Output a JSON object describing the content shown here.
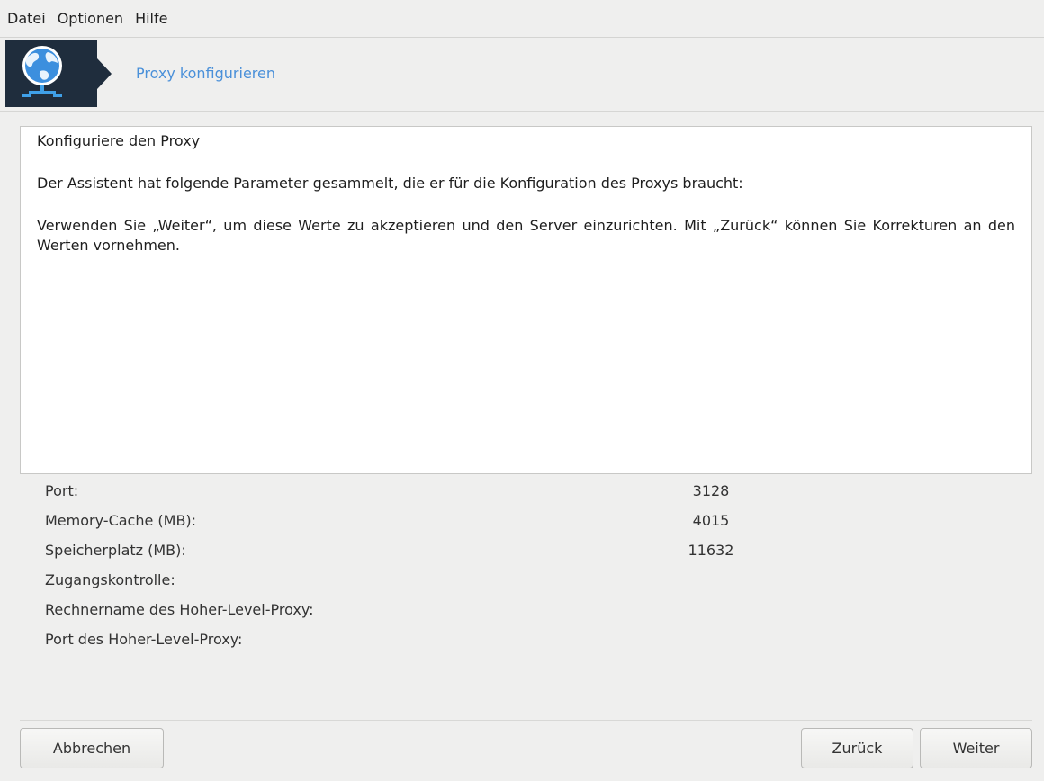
{
  "menubar": {
    "items": [
      "Datei",
      "Optionen",
      "Hilfe"
    ]
  },
  "header": {
    "title": "Proxy konfigurieren",
    "icon": "globe-network-icon"
  },
  "content": {
    "heading": "Konfiguriere den Proxy",
    "intro": "Der Assistent hat folgende Parameter gesammelt, die er für die Konfiguration des Proxys braucht:",
    "instructions": "Verwenden Sie „Weiter“, um diese Werte zu akzeptieren und den Server einzurichten. Mit „Zurück“ können Sie Korrekturen an den Werten vornehmen."
  },
  "parameters": [
    {
      "label": "Port:",
      "value": "3128"
    },
    {
      "label": "Memory-Cache (MB):",
      "value": "4015"
    },
    {
      "label": "Speicherplatz (MB):",
      "value": "11632"
    },
    {
      "label": "Zugangskontrolle:",
      "value": ""
    },
    {
      "label": "Rechnername des Hoher-Level-Proxy:",
      "value": ""
    },
    {
      "label": "Port des Hoher-Level-Proxy:",
      "value": ""
    }
  ],
  "buttons": {
    "cancel": "Abbrechen",
    "back": "Zurück",
    "next": "Weiter"
  },
  "colors": {
    "accent": "#4a90d9",
    "logo_bg": "#1f2d3d"
  }
}
